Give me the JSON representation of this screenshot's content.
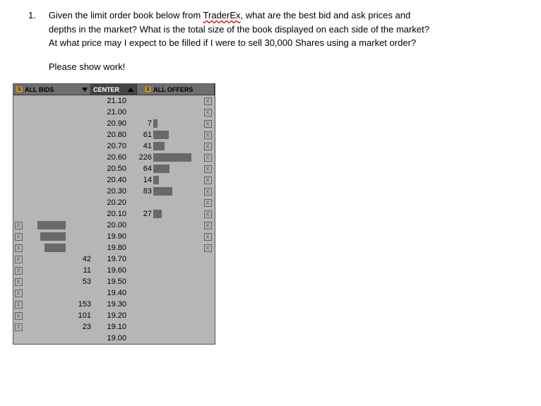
{
  "question": {
    "number": "1.",
    "line1a": "Given the limit order book below from ",
    "traderex": "TraderEx",
    "line1b": ", what are the best bid and ask prices and",
    "line2": "depths in the market? What is the total size of the book displayed on each side of the market?",
    "line3": "At what price may I expect to be filled if I were to sell 30,000 Shares using a market order?",
    "please": "Please show work!"
  },
  "book_header": {
    "bids": "ALL BIDS",
    "center": "CENTER",
    "offers": "ALL OFFERS"
  },
  "book_rows": [
    {
      "price": "21.10",
      "ask": "",
      "ask_bar": 0,
      "bid": "",
      "bid_bar": 0,
      "ask_x": true
    },
    {
      "price": "21.00",
      "ask": "",
      "ask_bar": 0,
      "bid": "",
      "bid_bar": 0,
      "ask_x": true
    },
    {
      "price": "20.90",
      "ask": "7",
      "ask_bar": 6,
      "bid": "",
      "bid_bar": 0,
      "ask_x": true
    },
    {
      "price": "20.80",
      "ask": "61",
      "ask_bar": 22,
      "bid": "",
      "bid_bar": 0,
      "ask_x": true
    },
    {
      "price": "20.70",
      "ask": "41",
      "ask_bar": 16,
      "bid": "",
      "bid_bar": 0,
      "ask_x": true
    },
    {
      "price": "20.60",
      "ask": "226",
      "ask_bar": 54,
      "bid": "",
      "bid_bar": 0,
      "ask_x": true
    },
    {
      "price": "20.50",
      "ask": "64",
      "ask_bar": 23,
      "bid": "",
      "bid_bar": 0,
      "ask_x": true
    },
    {
      "price": "20.40",
      "ask": "14",
      "ask_bar": 8,
      "bid": "",
      "bid_bar": 0,
      "ask_x": true
    },
    {
      "price": "20.30",
      "ask": "83",
      "ask_bar": 27,
      "bid": "",
      "bid_bar": 0,
      "ask_x": true
    },
    {
      "price": "20.20",
      "ask": "",
      "ask_bar": 0,
      "bid": "",
      "bid_bar": 0,
      "ask_x": true
    },
    {
      "price": "20.10",
      "ask": "27",
      "ask_bar": 12,
      "bid": "",
      "bid_bar": 0,
      "ask_x": true
    },
    {
      "price": "20.00",
      "ask": "",
      "ask_bar": 0,
      "bid": "",
      "bid_bar": 40,
      "bid_x": true,
      "ask_x": true
    },
    {
      "price": "19.90",
      "ask": "",
      "ask_bar": 0,
      "bid": "",
      "bid_bar": 36,
      "bid_x": true,
      "ask_x": true
    },
    {
      "price": "19.80",
      "ask": "",
      "ask_bar": 0,
      "bid": "",
      "bid_bar": 30,
      "bid_x": true,
      "ask_x": true
    },
    {
      "price": "19.70",
      "ask": "",
      "ask_bar": 0,
      "bid": "42",
      "bid_bar": 0,
      "bid_x": true
    },
    {
      "price": "19.60",
      "ask": "",
      "ask_bar": 0,
      "bid": "11",
      "bid_bar": 0,
      "bid_x": true
    },
    {
      "price": "19.50",
      "ask": "",
      "ask_bar": 0,
      "bid": "53",
      "bid_bar": 0,
      "bid_x": true
    },
    {
      "price": "19.40",
      "ask": "",
      "ask_bar": 0,
      "bid": "",
      "bid_bar": 0,
      "bid_x": true
    },
    {
      "price": "19.30",
      "ask": "",
      "ask_bar": 0,
      "bid": "153",
      "bid_bar": 0,
      "bid_x": true
    },
    {
      "price": "19.20",
      "ask": "",
      "ask_bar": 0,
      "bid": "101",
      "bid_bar": 0,
      "bid_x": true
    },
    {
      "price": "19.10",
      "ask": "",
      "ask_bar": 0,
      "bid": "23",
      "bid_bar": 0,
      "bid_x": true
    },
    {
      "price": "19.00",
      "ask": "",
      "ask_bar": 0,
      "bid": "",
      "bid_bar": 0
    }
  ]
}
